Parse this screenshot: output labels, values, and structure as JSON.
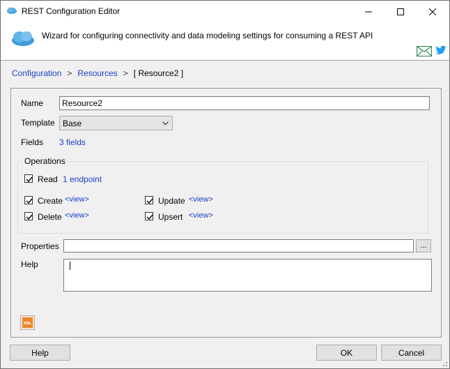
{
  "window": {
    "title": "REST Configuration Editor",
    "description": "Wizard for configuring connectivity and data modeling settings for consuming a REST API"
  },
  "breadcrumb": {
    "configuration": "Configuration",
    "resources": "Resources",
    "current": "[ Resource2 ]",
    "separator": ">"
  },
  "form": {
    "name_label": "Name",
    "name_value": "Resource2",
    "template_label": "Template",
    "template_value": "Base",
    "fields_label": "Fields",
    "fields_value": "3 fields",
    "operations_label": "Operations",
    "read_label": "Read",
    "read_link": "1 endpoint",
    "create_label": "Create",
    "create_link": "<view>",
    "update_label": "Update",
    "update_link": "<view>",
    "delete_label": "Delete",
    "delete_link": "<view>",
    "upsert_label": "Upsert",
    "upsert_link": "<view>",
    "properties_label": "Properties",
    "properties_value": "",
    "properties_button": "...",
    "help_label": "Help",
    "help_value": ""
  },
  "checkboxes": {
    "read": true,
    "create": true,
    "update": true,
    "delete": true,
    "upsert": true
  },
  "buttons": {
    "help": "Help",
    "ok": "OK",
    "cancel": "Cancel"
  },
  "icons": {
    "app": "cloud-icon",
    "header": "cloud-icon",
    "mail": "mail-icon",
    "twitter": "twitter-icon",
    "xml": "xml-icon"
  },
  "colors": {
    "link": "#1a3fc7",
    "twitter": "#1da1f2",
    "mail": "#2e8b57",
    "xml": "#e8882a"
  }
}
